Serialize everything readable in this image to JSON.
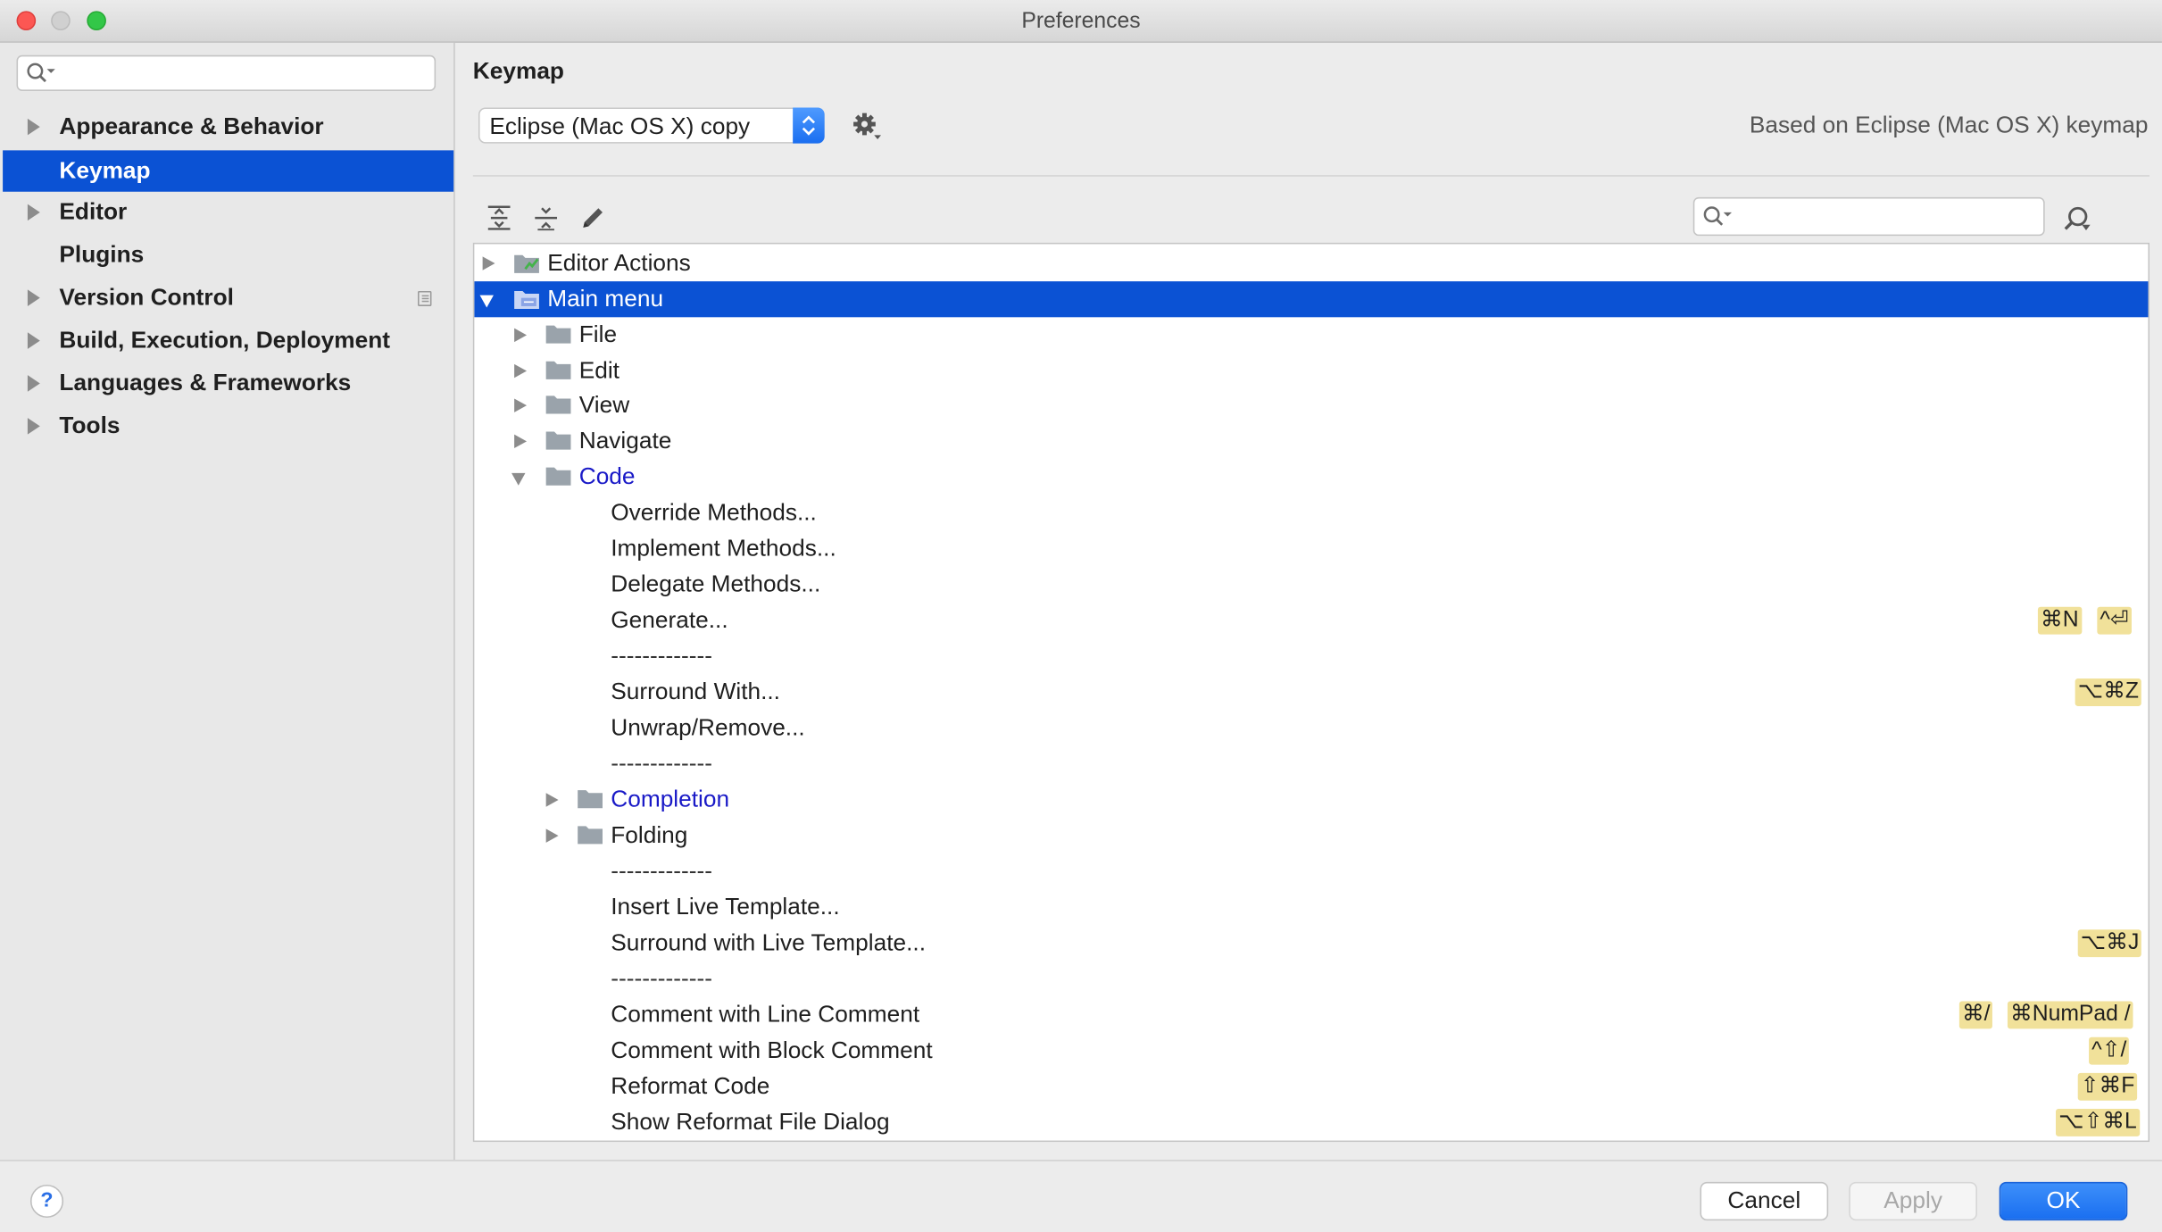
{
  "window": {
    "title": "Preferences"
  },
  "sidebar": {
    "search_placeholder": "",
    "items": [
      {
        "label": "Appearance & Behavior",
        "expandable": true
      },
      {
        "label": "Keymap",
        "selected": true
      },
      {
        "label": "Editor",
        "expandable": true
      },
      {
        "label": "Plugins"
      },
      {
        "label": "Version Control",
        "expandable": true,
        "icon": "project-config-icon"
      },
      {
        "label": "Build, Execution, Deployment",
        "expandable": true
      },
      {
        "label": "Languages & Frameworks",
        "expandable": true
      },
      {
        "label": "Tools",
        "expandable": true
      }
    ]
  },
  "keymap": {
    "title": "Keymap",
    "selected_keymap": "Eclipse (Mac OS X) copy",
    "based_on": "Based on Eclipse (Mac OS X) keymap",
    "toolbar_icons": [
      "expand-all-icon",
      "collapse-all-icon",
      "edit-icon"
    ],
    "search_placeholder": "",
    "find_by_shortcut_icon": "find-shortcut-icon"
  },
  "tree": [
    {
      "label": "Editor Actions",
      "icon": "editor-actions-icon"
    },
    {
      "label": "Main menu",
      "icon": "main-menu-icon"
    },
    {
      "label": "File",
      "icon": "folder-icon"
    },
    {
      "label": "Edit",
      "icon": "folder-icon"
    },
    {
      "label": "View",
      "icon": "folder-icon"
    },
    {
      "label": "Navigate",
      "icon": "folder-icon"
    },
    {
      "label": "Code",
      "icon": "folder-icon"
    },
    {
      "label": "Override Methods..."
    },
    {
      "label": "Implement Methods..."
    },
    {
      "label": "Delegate Methods..."
    },
    {
      "label": "Generate...",
      "shortcuts": [
        "⌘N",
        "^⏎"
      ]
    },
    {
      "label": "-------------"
    },
    {
      "label": "Surround With...",
      "shortcuts": [
        "⌥⌘Z"
      ]
    },
    {
      "label": "Unwrap/Remove..."
    },
    {
      "label": "-------------"
    },
    {
      "label": "Completion",
      "icon": "folder-icon"
    },
    {
      "label": "Folding",
      "icon": "folder-icon"
    },
    {
      "label": "-------------"
    },
    {
      "label": "Insert Live Template..."
    },
    {
      "label": "Surround with Live Template...",
      "shortcuts": [
        "⌥⌘J"
      ]
    },
    {
      "label": "-------------"
    },
    {
      "label": "Comment with Line Comment",
      "shortcuts": [
        "⌘/",
        "⌘NumPad /"
      ]
    },
    {
      "label": "Comment with Block Comment",
      "shortcuts": [
        "^⇧/"
      ]
    },
    {
      "label": "Reformat Code",
      "shortcuts": [
        "⇧⌘F"
      ]
    },
    {
      "label": "Show Reformat File Dialog",
      "shortcuts": [
        "⌥⇧⌘L"
      ]
    }
  ],
  "buttons": {
    "help": "?",
    "cancel": "Cancel",
    "apply": "Apply",
    "ok": "OK"
  },
  "colors": {
    "selection": "#0b52d4",
    "shortcut_bg": "#f1e19a",
    "link": "#1a1ac7",
    "ok_button": "#2a7ef6"
  }
}
